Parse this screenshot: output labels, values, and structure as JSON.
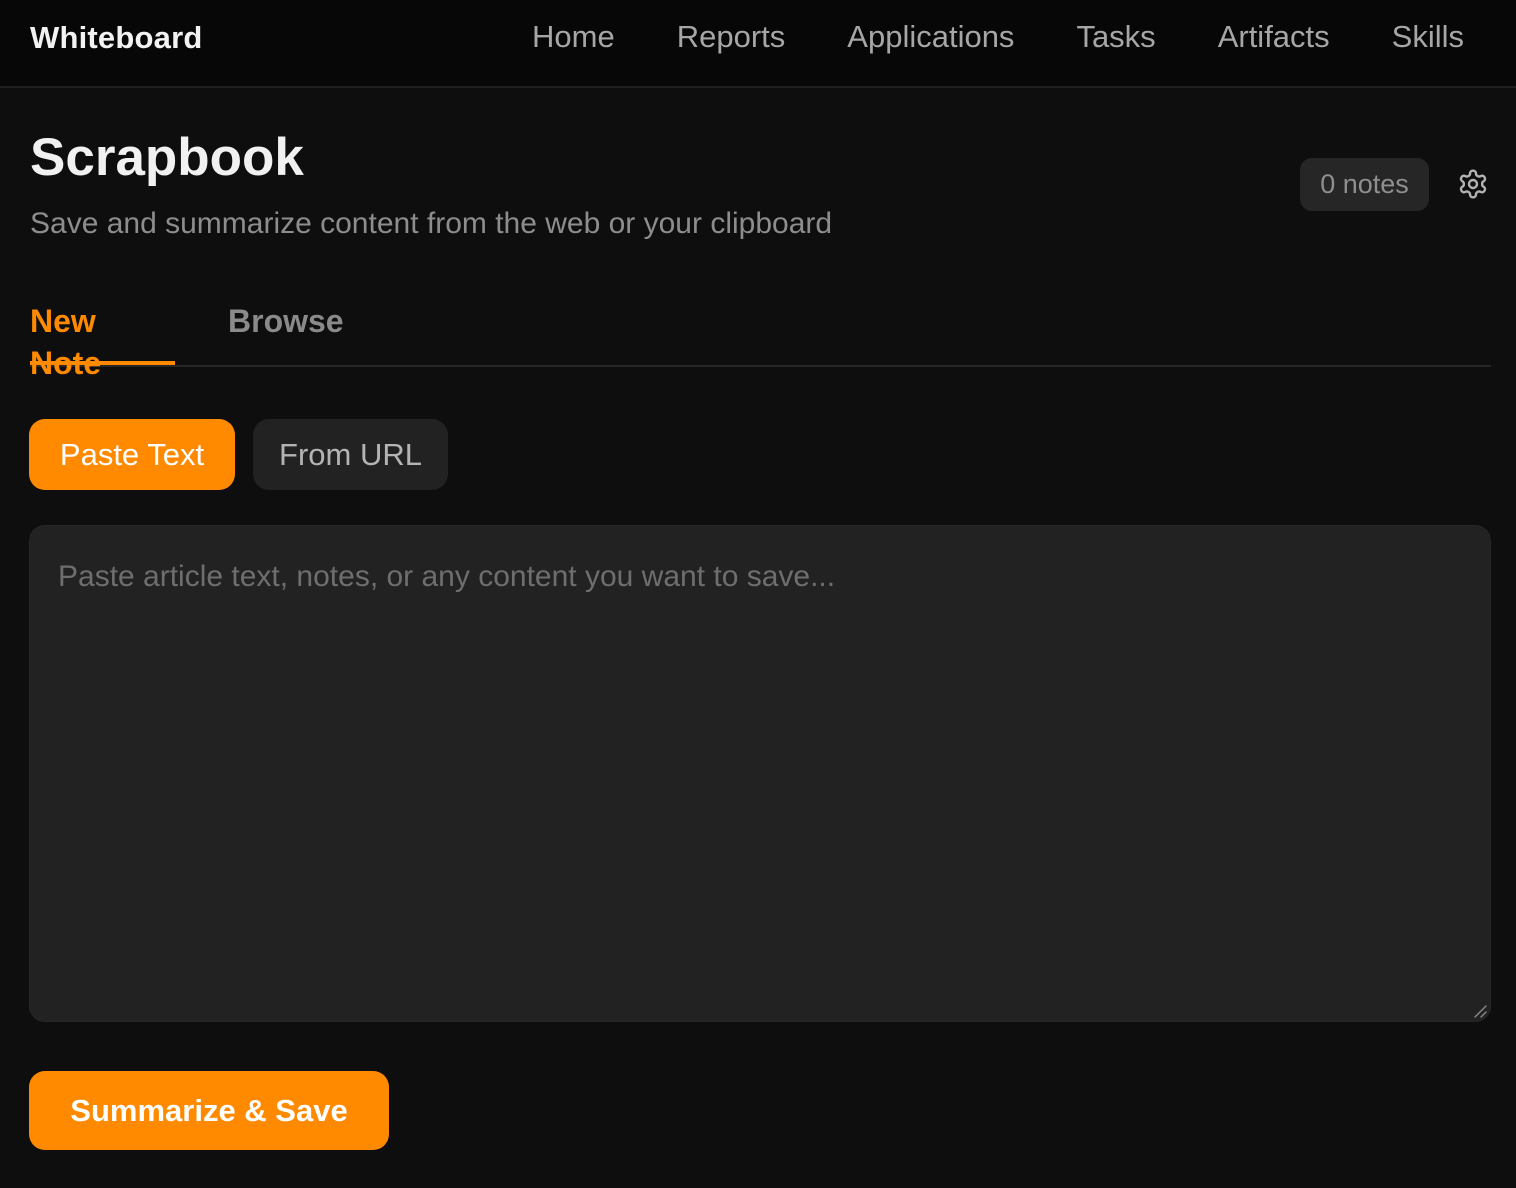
{
  "app": {
    "brand": "Whiteboard"
  },
  "nav": {
    "items": [
      {
        "label": "Home"
      },
      {
        "label": "Reports"
      },
      {
        "label": "Applications"
      },
      {
        "label": "Tasks"
      },
      {
        "label": "Artifacts"
      },
      {
        "label": "Skills"
      }
    ]
  },
  "header": {
    "title": "Scrapbook",
    "subtitle": "Save and summarize content from the web or your clipboard",
    "notes_count": "0 notes",
    "settings_icon": "gear-icon"
  },
  "tabs": [
    {
      "label": "New Note",
      "active": true
    },
    {
      "label": "Browse",
      "active": false
    }
  ],
  "mode": {
    "paste_label": "Paste Text",
    "url_label": "From URL",
    "selected": "Paste Text"
  },
  "editor": {
    "value": "",
    "placeholder": "Paste article text, notes, or any content you want to save..."
  },
  "actions": {
    "submit_label": "Summarize & Save"
  },
  "colors": {
    "accent": "#ff8a00",
    "background": "#0e0e0e",
    "surface": "#222222"
  }
}
